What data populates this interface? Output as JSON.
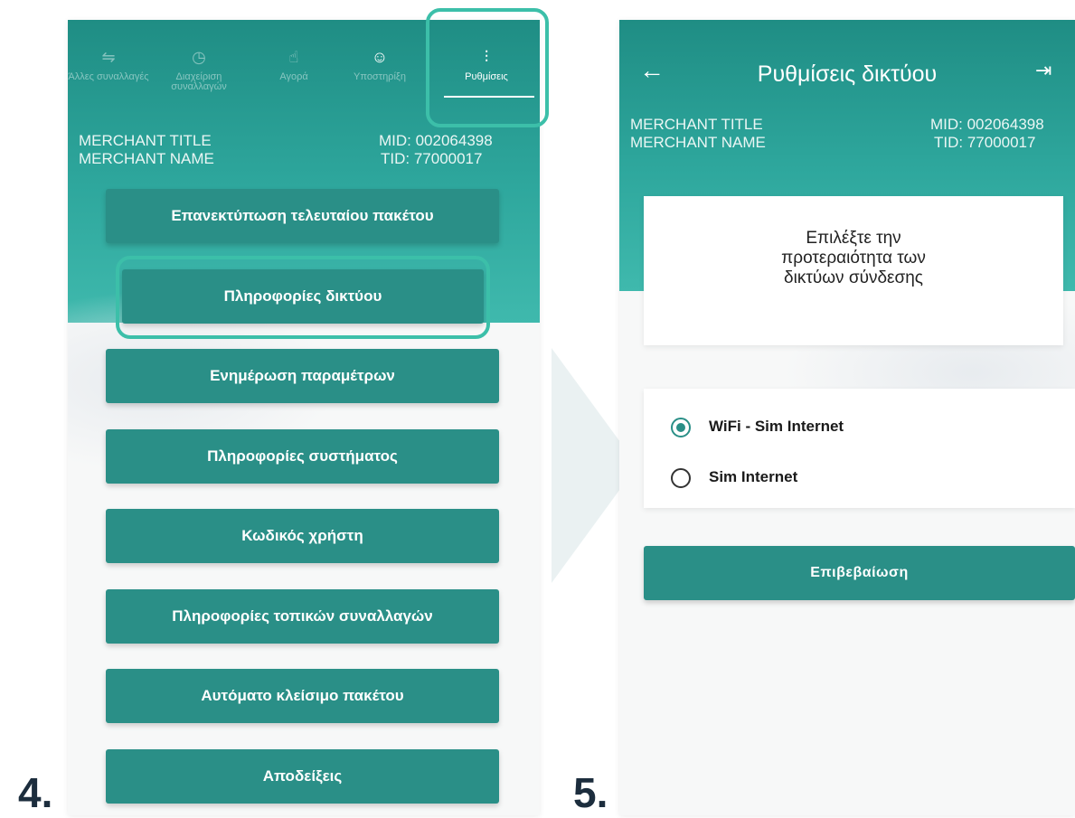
{
  "step_labels": {
    "left": "4.",
    "right": "5."
  },
  "settings_screen": {
    "tabs": [
      {
        "label": "Άλλες συναλλαγές",
        "icon": "transactions-icon"
      },
      {
        "label": "Διαχείριση συναλλαγών",
        "icon": "manage-transactions-icon"
      },
      {
        "label": "Αγορά",
        "icon": "purchase-icon"
      },
      {
        "label": "Υποστηρίξη",
        "icon": "support-icon"
      },
      {
        "label": "Ρυθμίσεις",
        "icon": "settings-sliders-icon",
        "active": true
      }
    ],
    "merchant_title": "MERCHANT TITLE",
    "merchant_name": "MERCHANT NAME",
    "mid": "MID: 002064398",
    "tid": "TID: 77000017",
    "menu": [
      "Επανεκτύπωση τελευταίου πακέτου",
      "Πληροφορίες δικτύου",
      "Ενημέρωση παραμέτρων",
      "Πληροφορίες συστήματος",
      "Κωδικός χρήστη",
      "Πληροφορίες τοπικών συναλλαγών",
      "Αυτόματο κλείσιμο πακέτου",
      "Αποδείξεις"
    ],
    "highlighted": [
      "Ρυθμίσεις",
      "Πληροφορίες δικτύου"
    ]
  },
  "network_screen": {
    "title": "Ρυθμίσεις δικτύου",
    "back_icon": "arrow-left-icon",
    "exit_icon": "logout-icon",
    "merchant_title": "MERCHANT TITLE",
    "merchant_name": "MERCHANT NAME",
    "mid": "MID: 002064398",
    "tid": "TID: 77000017",
    "prompt_line1": "Επιλέξτε την",
    "prompt_line2": "προτεραιότητα των",
    "prompt_line3": "δικτύων σύνδεσης",
    "options": [
      {
        "label": "WiFi - Sim Internet",
        "selected": true
      },
      {
        "label": "Sim Internet",
        "selected": false
      }
    ],
    "confirm_label": "Επιβεβαίωση"
  },
  "colors": {
    "primary": "#2a8f87",
    "highlight": "#3cbfa9",
    "header_gradient_top": "#1f8d84",
    "header_gradient_bottom": "#3fb9ad"
  }
}
